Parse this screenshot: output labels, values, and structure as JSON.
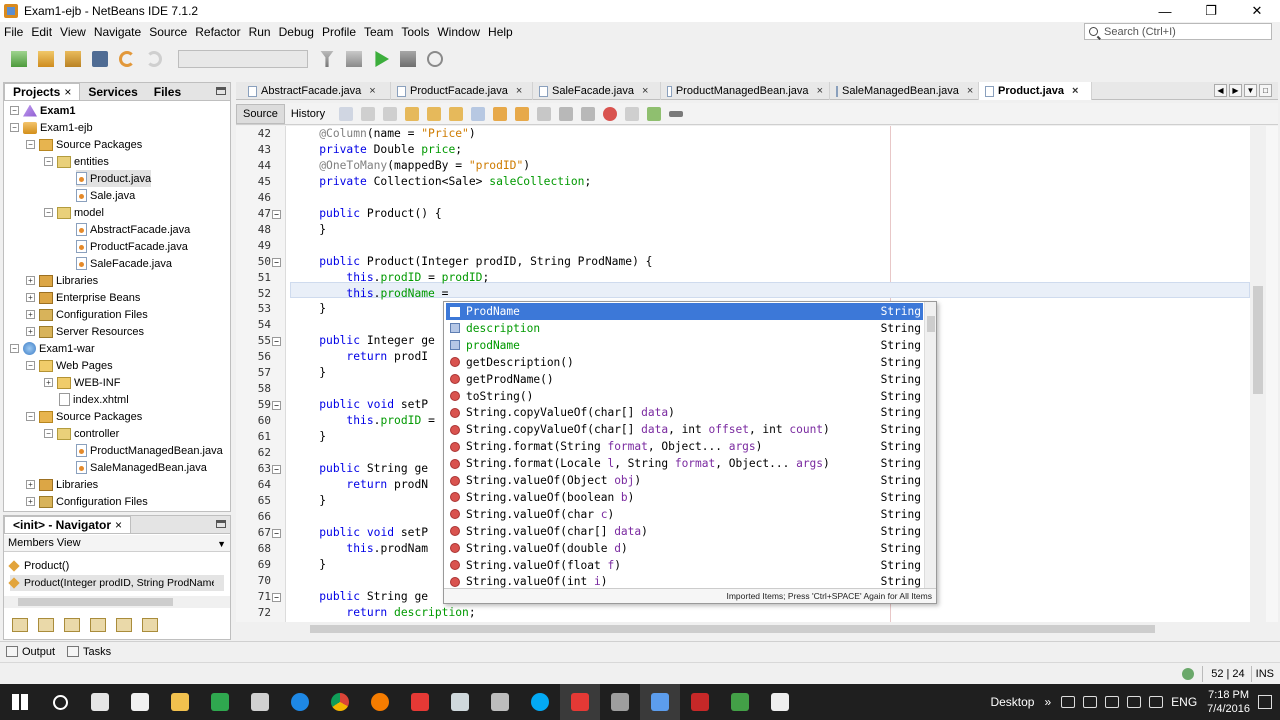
{
  "window": {
    "title": "Exam1-ejb - NetBeans IDE 7.1.2",
    "controls": [
      "—",
      "❐",
      "✕"
    ]
  },
  "menu": [
    "File",
    "Edit",
    "View",
    "Navigate",
    "Source",
    "Refactor",
    "Run",
    "Debug",
    "Profile",
    "Team",
    "Tools",
    "Window",
    "Help"
  ],
  "search": {
    "placeholder": "Search (Ctrl+I)"
  },
  "toolbar": {
    "icons": [
      "new-file-icon",
      "new-project-icon",
      "open-project-icon",
      "save-all-icon",
      "undo-icon",
      "redo-icon",
      "build-icon",
      "clean-build-icon",
      "run-icon",
      "debug-icon",
      "profile-icon"
    ]
  },
  "projects_panel": {
    "tabs": [
      {
        "label": "Projects",
        "close": "×"
      },
      {
        "label": "Services"
      },
      {
        "label": "Files"
      }
    ],
    "tree": [
      {
        "label": "Exam1",
        "bold": true
      },
      {
        "label": "Exam1-ejb"
      },
      {
        "label": "Source Packages"
      },
      {
        "label": "entities"
      },
      {
        "label": "Product.java"
      },
      {
        "label": "Sale.java"
      },
      {
        "label": "model"
      },
      {
        "label": "AbstractFacade.java"
      },
      {
        "label": "ProductFacade.java"
      },
      {
        "label": "SaleFacade.java"
      },
      {
        "label": "Libraries"
      },
      {
        "label": "Enterprise Beans"
      },
      {
        "label": "Configuration Files"
      },
      {
        "label": "Server Resources"
      },
      {
        "label": "Exam1-war"
      },
      {
        "label": "Web Pages"
      },
      {
        "label": "WEB-INF"
      },
      {
        "label": "index.xhtml"
      },
      {
        "label": "Source Packages"
      },
      {
        "label": "controller"
      },
      {
        "label": "ProductManagedBean.java"
      },
      {
        "label": "SaleManagedBean.java"
      },
      {
        "label": "Libraries"
      },
      {
        "label": "Configuration Files"
      }
    ]
  },
  "navigator": {
    "title": "<init> - Navigator",
    "close": "×",
    "view": "Members View",
    "members": [
      {
        "label": "Product()"
      },
      {
        "label": "Product(Integer prodID, String ProdName)"
      }
    ]
  },
  "editor": {
    "tabs": [
      {
        "label": "AbstractFacade.java",
        "close": "×"
      },
      {
        "label": "ProductFacade.java",
        "close": "×"
      },
      {
        "label": "SaleFacade.java",
        "close": "×"
      },
      {
        "label": "ProductManagedBean.java",
        "close": "×"
      },
      {
        "label": "SaleManagedBean.java",
        "close": "×"
      },
      {
        "label": "Product.java",
        "close": "×",
        "active": true
      }
    ],
    "views": [
      "Source",
      "History"
    ],
    "line_numbers": [
      "42",
      "43",
      "44",
      "45",
      "46",
      "47",
      "48",
      "49",
      "50",
      "51",
      "52",
      "53",
      "54",
      "55",
      "56",
      "57",
      "58",
      "59",
      "60",
      "61",
      "62",
      "63",
      "64",
      "65",
      "66",
      "67",
      "68",
      "69",
      "70",
      "71",
      "72"
    ],
    "code": [
      "    @Column(name = \"Price\")",
      "    private Double price;",
      "    @OneToMany(mappedBy = \"prodID\")",
      "    private Collection<Sale> saleCollection;",
      "",
      "    public Product() {",
      "    }",
      "",
      "    public Product(Integer prodID, String ProdName) {",
      "        this.prodID = prodID;",
      "        this.prodName = ",
      "    }",
      "",
      "    public Integer ge",
      "        return prodI",
      "    }",
      "",
      "    public void setP",
      "        this.prodID =",
      "    }",
      "",
      "    public String ge",
      "        return prodN",
      "    }",
      "",
      "    public void setP",
      "        this.prodNam",
      "    }",
      "",
      "    public String ge",
      "        return description;"
    ]
  },
  "completion": {
    "items": [
      {
        "kind": "field",
        "name": "ProdName",
        "params": "",
        "type": "String"
      },
      {
        "kind": "field",
        "name": "description",
        "params": "",
        "type": "String"
      },
      {
        "kind": "field",
        "name": "prodName",
        "params": "",
        "type": "String"
      },
      {
        "kind": "method",
        "name": "getDescription",
        "params": "()",
        "type": "String"
      },
      {
        "kind": "method",
        "name": "getProdName",
        "params": "()",
        "type": "String"
      },
      {
        "kind": "method",
        "name": "toString",
        "params": "()",
        "type": "String"
      },
      {
        "kind": "method",
        "name": "String.copyValueOf",
        "params": "(char[] data)",
        "type": "String"
      },
      {
        "kind": "method",
        "name": "String.copyValueOf",
        "params": "(char[] data, int offset, int count)",
        "type": "String"
      },
      {
        "kind": "method",
        "name": "String.format",
        "params": "(String format, Object... args)",
        "type": "String"
      },
      {
        "kind": "method",
        "name": "String.format",
        "params": "(Locale l, String format, Object... args)",
        "type": "String"
      },
      {
        "kind": "method",
        "name": "String.valueOf",
        "params": "(Object obj)",
        "type": "String"
      },
      {
        "kind": "method",
        "name": "String.valueOf",
        "params": "(boolean b)",
        "type": "String"
      },
      {
        "kind": "method",
        "name": "String.valueOf",
        "params": "(char c)",
        "type": "String"
      },
      {
        "kind": "method",
        "name": "String.valueOf",
        "params": "(char[] data)",
        "type": "String"
      },
      {
        "kind": "method",
        "name": "String.valueOf",
        "params": "(double d)",
        "type": "String"
      },
      {
        "kind": "method",
        "name": "String.valueOf",
        "params": "(float f)",
        "type": "String"
      },
      {
        "kind": "method",
        "name": "String.valueOf",
        "params": "(int i)",
        "type": "String"
      }
    ],
    "footer": "Imported Items; Press 'Ctrl+SPACE' Again for All Items"
  },
  "output_bar": {
    "output": "Output",
    "tasks": "Tasks"
  },
  "status": {
    "position": "52 | 24",
    "mode": "INS"
  },
  "taskbar": {
    "desktop_label": "Desktop",
    "chevron": "»",
    "language": "ENG",
    "time": "7:18 PM",
    "date": "7/4/2016"
  },
  "colors": {
    "keyword": "#0000e6",
    "field": "#009900",
    "string": "#ce7b00",
    "annotation": "#808080",
    "selection": "#3c78d8"
  }
}
